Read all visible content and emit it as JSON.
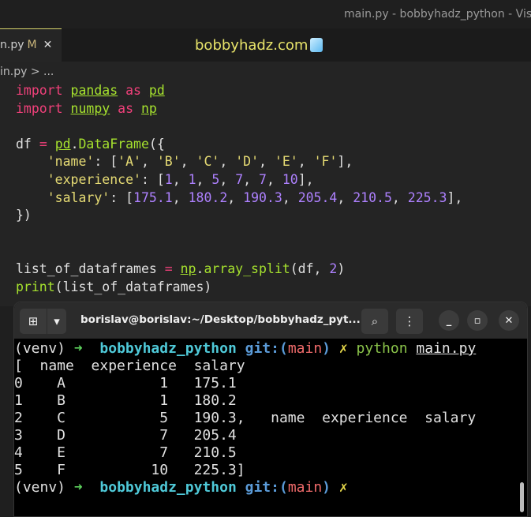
{
  "window_title": "main.py - bobbyhadz_python - Visu",
  "tab": {
    "name": "n.py",
    "status": "M",
    "close": "✕"
  },
  "brand": "bobbyhadz.com",
  "breadcrumb": "in.py > ...",
  "code": [
    [
      [
        "k",
        "import"
      ],
      [
        "w",
        " "
      ],
      [
        "g u",
        "pandas"
      ],
      [
        "w",
        " "
      ],
      [
        "k",
        "as"
      ],
      [
        "w",
        " "
      ],
      [
        "g u",
        "pd"
      ]
    ],
    [
      [
        "k",
        "import"
      ],
      [
        "w",
        " "
      ],
      [
        "g u",
        "numpy"
      ],
      [
        "w",
        " "
      ],
      [
        "k",
        "as"
      ],
      [
        "w",
        " "
      ],
      [
        "g u",
        "np"
      ]
    ],
    [],
    [
      [
        "w",
        "df "
      ],
      [
        "k",
        "="
      ],
      [
        "w",
        " "
      ],
      [
        "g u",
        "pd"
      ],
      [
        "w",
        "."
      ],
      [
        "g",
        "DataFrame"
      ],
      [
        "w",
        "({"
      ]
    ],
    [
      [
        "w",
        "    "
      ],
      [
        "s",
        "'name'"
      ],
      [
        "w",
        ": ["
      ],
      [
        "s",
        "'A'"
      ],
      [
        "w",
        ", "
      ],
      [
        "s",
        "'B'"
      ],
      [
        "w",
        ", "
      ],
      [
        "s",
        "'C'"
      ],
      [
        "w",
        ", "
      ],
      [
        "s",
        "'D'"
      ],
      [
        "w",
        ", "
      ],
      [
        "s",
        "'E'"
      ],
      [
        "w",
        ", "
      ],
      [
        "s",
        "'F'"
      ],
      [
        "w",
        "],"
      ]
    ],
    [
      [
        "w",
        "    "
      ],
      [
        "s",
        "'experience'"
      ],
      [
        "w",
        ": ["
      ],
      [
        "n",
        "1"
      ],
      [
        "w",
        ", "
      ],
      [
        "n",
        "1"
      ],
      [
        "w",
        ", "
      ],
      [
        "n",
        "5"
      ],
      [
        "w",
        ", "
      ],
      [
        "n",
        "7"
      ],
      [
        "w",
        ", "
      ],
      [
        "n",
        "7"
      ],
      [
        "w",
        ", "
      ],
      [
        "n",
        "10"
      ],
      [
        "w",
        "],"
      ]
    ],
    [
      [
        "w",
        "    "
      ],
      [
        "s",
        "'salary'"
      ],
      [
        "w",
        ": ["
      ],
      [
        "n",
        "175.1"
      ],
      [
        "w",
        ", "
      ],
      [
        "n",
        "180.2"
      ],
      [
        "w",
        ", "
      ],
      [
        "n",
        "190.3"
      ],
      [
        "w",
        ", "
      ],
      [
        "n",
        "205.4"
      ],
      [
        "w",
        ", "
      ],
      [
        "n",
        "210.5"
      ],
      [
        "w",
        ", "
      ],
      [
        "n",
        "225.3"
      ],
      [
        "w",
        "],"
      ]
    ],
    [
      [
        "w",
        "})"
      ]
    ],
    [],
    [],
    [
      [
        "w",
        "list_of_dataframes "
      ],
      [
        "k",
        "="
      ],
      [
        "w",
        " "
      ],
      [
        "g u",
        "np"
      ],
      [
        "w",
        "."
      ],
      [
        "g",
        "array_split"
      ],
      [
        "w",
        "(df, "
      ],
      [
        "n",
        "2"
      ],
      [
        "w",
        ")"
      ]
    ],
    [
      [
        "g",
        "print"
      ],
      [
        "w",
        "(list_of_dataframes)"
      ]
    ]
  ],
  "terminal": {
    "title": "borislav@borislav:~/Desktop/bobbyhadz_pyt...",
    "lines": [
      [
        [
          "w",
          "(venv) "
        ],
        [
          "gr",
          "➜"
        ],
        [
          "w",
          "  "
        ],
        [
          "cy",
          "bobbyhadz_python"
        ],
        [
          "w",
          " "
        ],
        [
          "bl",
          "git:("
        ],
        [
          "rd",
          "main"
        ],
        [
          "bl",
          ")"
        ],
        [
          "w",
          " "
        ],
        [
          "ye",
          "✗"
        ],
        [
          "w",
          " "
        ],
        [
          "pg",
          "python"
        ],
        [
          "w",
          " "
        ],
        [
          "ul",
          "main.py"
        ]
      ],
      [
        [
          "w",
          "[  name  experience  salary"
        ]
      ],
      [
        [
          "w",
          "0    A           1   175.1"
        ]
      ],
      [
        [
          "w",
          "1    B           1   180.2"
        ]
      ],
      [
        [
          "w",
          "2    C           5   190.3,   name  experience  salary"
        ]
      ],
      [
        [
          "w",
          "3    D           7   205.4"
        ]
      ],
      [
        [
          "w",
          "4    E           7   210.5"
        ]
      ],
      [
        [
          "w",
          "5    F          10   225.3]"
        ]
      ],
      [
        [
          "w",
          "(venv) "
        ],
        [
          "gr",
          "➜"
        ],
        [
          "w",
          "  "
        ],
        [
          "cy",
          "bobbyhadz_python"
        ],
        [
          "w",
          " "
        ],
        [
          "bl",
          "git:("
        ],
        [
          "rd",
          "main"
        ],
        [
          "bl",
          ")"
        ],
        [
          "w",
          " "
        ],
        [
          "ye",
          "✗"
        ]
      ]
    ]
  }
}
